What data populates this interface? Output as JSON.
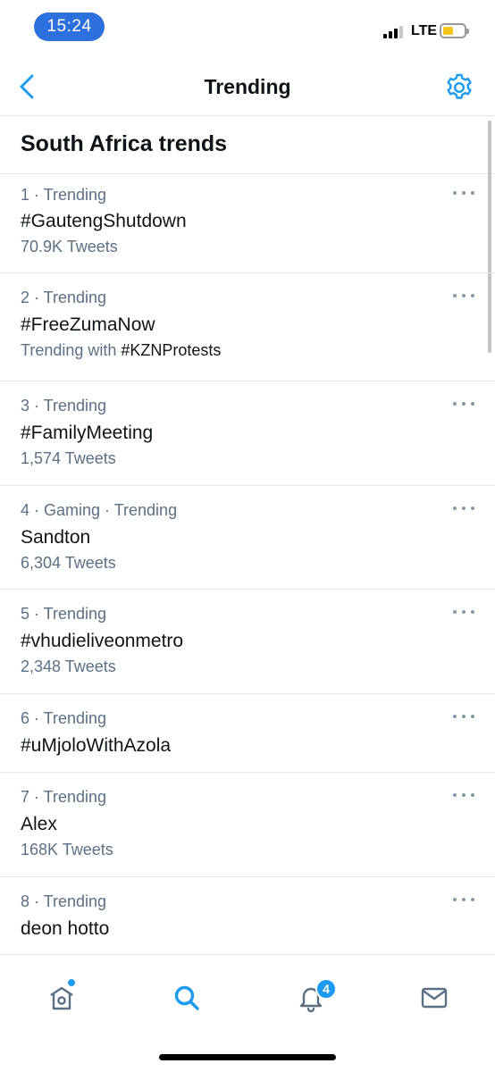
{
  "status_bar": {
    "time": "15:24",
    "network": "LTE"
  },
  "nav": {
    "title": "Trending",
    "back_icon": "chevron-left-icon",
    "settings_icon": "gear-icon"
  },
  "section": {
    "title": "South Africa trends"
  },
  "trends": [
    {
      "meta": "1 · Trending",
      "name": "#GautengShutdown",
      "sub": "70.9K Tweets"
    },
    {
      "meta": "2 · Trending",
      "name": "#FreeZumaNow",
      "sub_prefix": "Trending with ",
      "sub_tag": "#KZNProtests"
    },
    {
      "meta": "3 · Trending",
      "name": "#FamilyMeeting",
      "sub": "1,574 Tweets"
    },
    {
      "meta": "4 · Gaming · Trending",
      "name": "Sandton",
      "sub": "6,304 Tweets"
    },
    {
      "meta": "5 · Trending",
      "name": "#vhudieliveonmetro",
      "sub": "2,348 Tweets"
    },
    {
      "meta": "6 · Trending",
      "name": "#uMjoloWithAzola"
    },
    {
      "meta": "7 · Trending",
      "name": "Alex",
      "sub": "168K Tweets"
    },
    {
      "meta": "8 · Trending",
      "name": "deon hotto"
    }
  ],
  "tab_bar": {
    "notifications_badge": "4",
    "icons": [
      "home-icon",
      "search-icon",
      "bell-icon",
      "mail-icon"
    ]
  },
  "colors": {
    "accent": "#1d9bf0",
    "time_pill": "#2d6fdc",
    "muted": "#5b7083"
  }
}
